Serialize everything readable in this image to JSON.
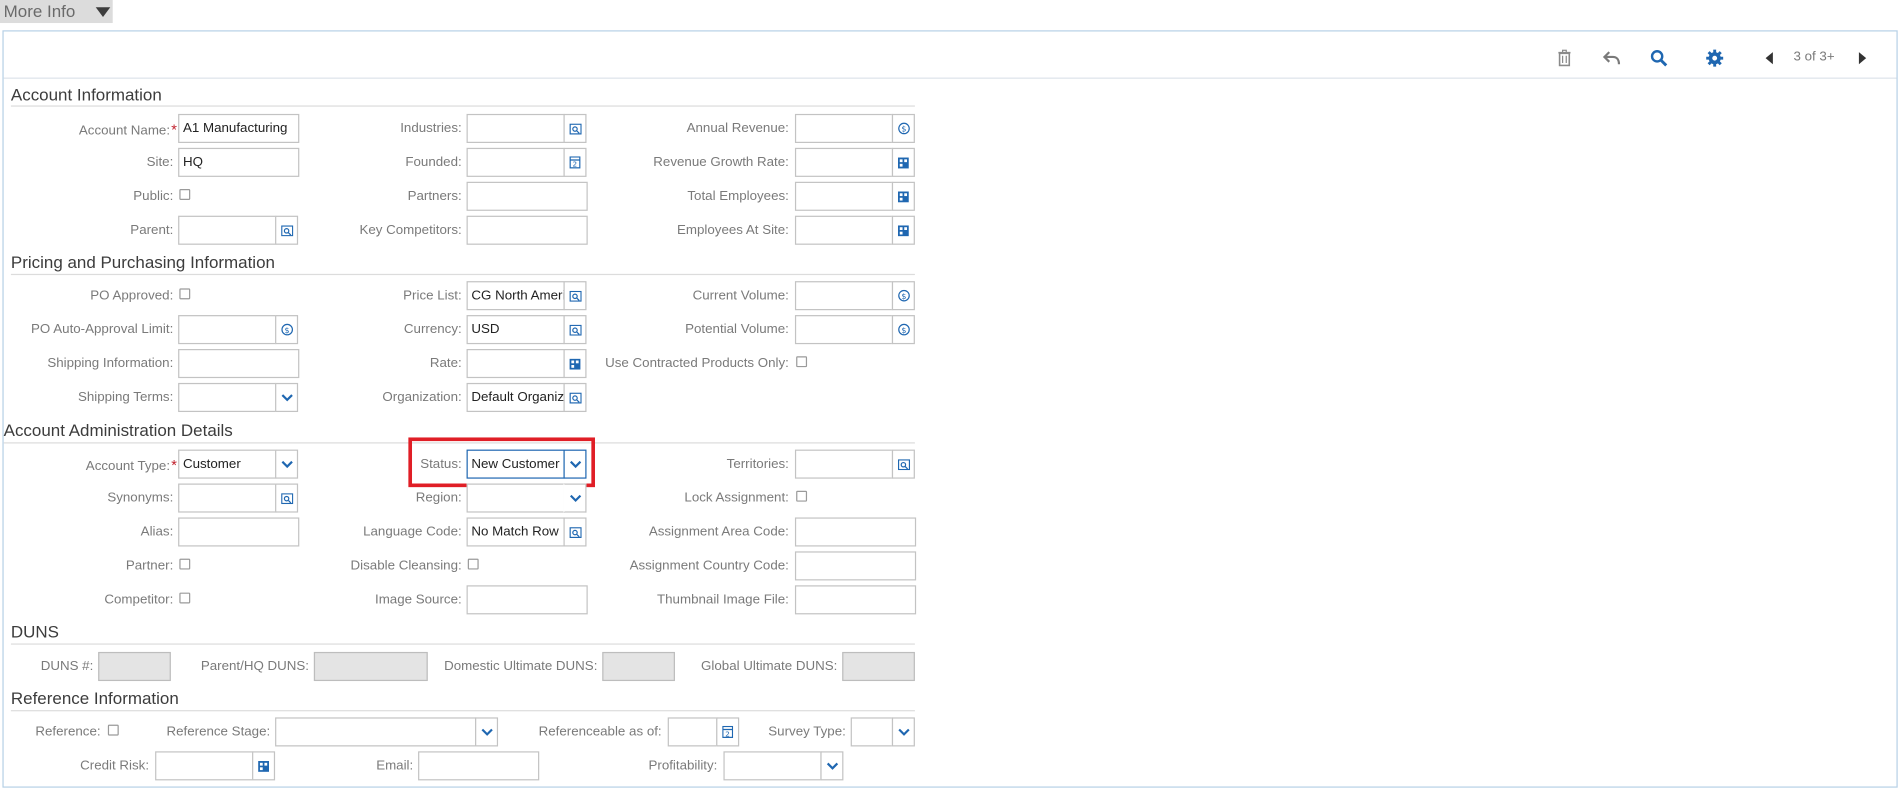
{
  "more_info": {
    "label": "More Info"
  },
  "toolbar": {
    "pager": "3 of 3+"
  },
  "sections": {
    "account": "Account Information",
    "pricing": "Pricing and Purchasing Information",
    "admin": "Account Administration Details",
    "duns": "DUNS",
    "reference": "Reference Information"
  },
  "labels": {
    "account_name": "Account Name:",
    "site": "Site:",
    "public": "Public:",
    "parent": "Parent:",
    "industries": "Industries:",
    "founded": "Founded:",
    "partners": "Partners:",
    "key_competitors": "Key Competitors:",
    "annual_revenue": "Annual Revenue:",
    "revenue_growth": "Revenue Growth Rate:",
    "total_employees": "Total Employees:",
    "employees_site": "Employees At Site:",
    "po_approved": "PO Approved:",
    "po_limit": "PO Auto-Approval Limit:",
    "shipping_info": "Shipping Information:",
    "shipping_terms": "Shipping Terms:",
    "price_list": "Price List:",
    "currency": "Currency:",
    "rate": "Rate:",
    "organization": "Organization:",
    "current_volume": "Current Volume:",
    "potential_volume": "Potential Volume:",
    "contracted_only": "Use Contracted Products Only:",
    "account_type": "Account Type:",
    "synonyms": "Synonyms:",
    "alias": "Alias:",
    "partner": "Partner:",
    "competitor": "Competitor:",
    "status": "Status:",
    "region": "Region:",
    "language_code": "Language Code:",
    "disable_cleansing": "Disable Cleansing:",
    "image_source": "Image Source:",
    "territories": "Territories:",
    "lock_assignment": "Lock Assignment:",
    "area_code": "Assignment Area Code:",
    "country_code": "Assignment Country Code:",
    "thumbnail": "Thumbnail Image File:",
    "duns_num": "DUNS #:",
    "parent_duns": "Parent/HQ DUNS:",
    "domestic_duns": "Domestic Ultimate DUNS:",
    "global_duns": "Global Ultimate DUNS:",
    "reference": "Reference:",
    "reference_stage": "Reference Stage:",
    "referenceable_as_of": "Referenceable as of:",
    "survey_type": "Survey Type:",
    "credit_risk": "Credit Risk:",
    "email": "Email:",
    "profitability": "Profitability:"
  },
  "values": {
    "account_name": "A1 Manufacturing",
    "site": "HQ",
    "price_list": "CG North America",
    "currency": "USD",
    "organization": "Default Organization",
    "account_type": "Customer",
    "status": "New Customer",
    "language_code": "No Match Row Id"
  },
  "required_marker": "*",
  "colors": {
    "accent": "#1f67b1",
    "highlight": "#e01e26",
    "required": "#c0202c"
  }
}
